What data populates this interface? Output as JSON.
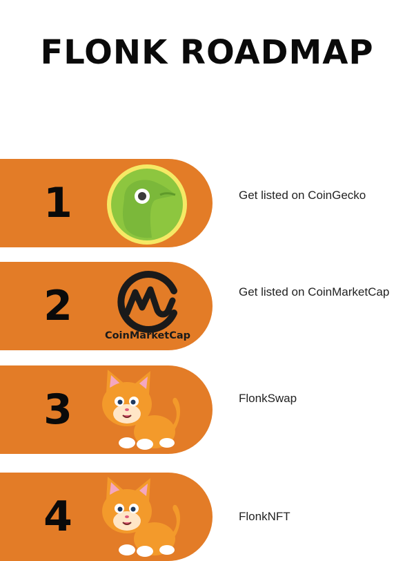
{
  "page": {
    "title": "FLONK  ROADMAP"
  },
  "roadmap": {
    "steps": [
      {
        "number": "1",
        "label": "Get listed on CoinGecko",
        "icon": "coingecko-logo"
      },
      {
        "number": "2",
        "label": "Get listed on CoinMarketCap",
        "icon": "coinmarketcap-logo",
        "logo_text": "CoinMarketCap"
      },
      {
        "number": "3",
        "label": "FlonkSwap",
        "icon": "cartoon-cat"
      },
      {
        "number": "4",
        "label": "FlonkNFT",
        "icon": "cartoon-cat"
      }
    ]
  },
  "colors": {
    "pill": "#e37c27",
    "text": "#0a0a0a",
    "coingecko_green": "#8dc63f",
    "coingecko_yellow": "#f5e965",
    "cat_orange": "#f39a2b",
    "cat_pink": "#f4a7c0"
  }
}
